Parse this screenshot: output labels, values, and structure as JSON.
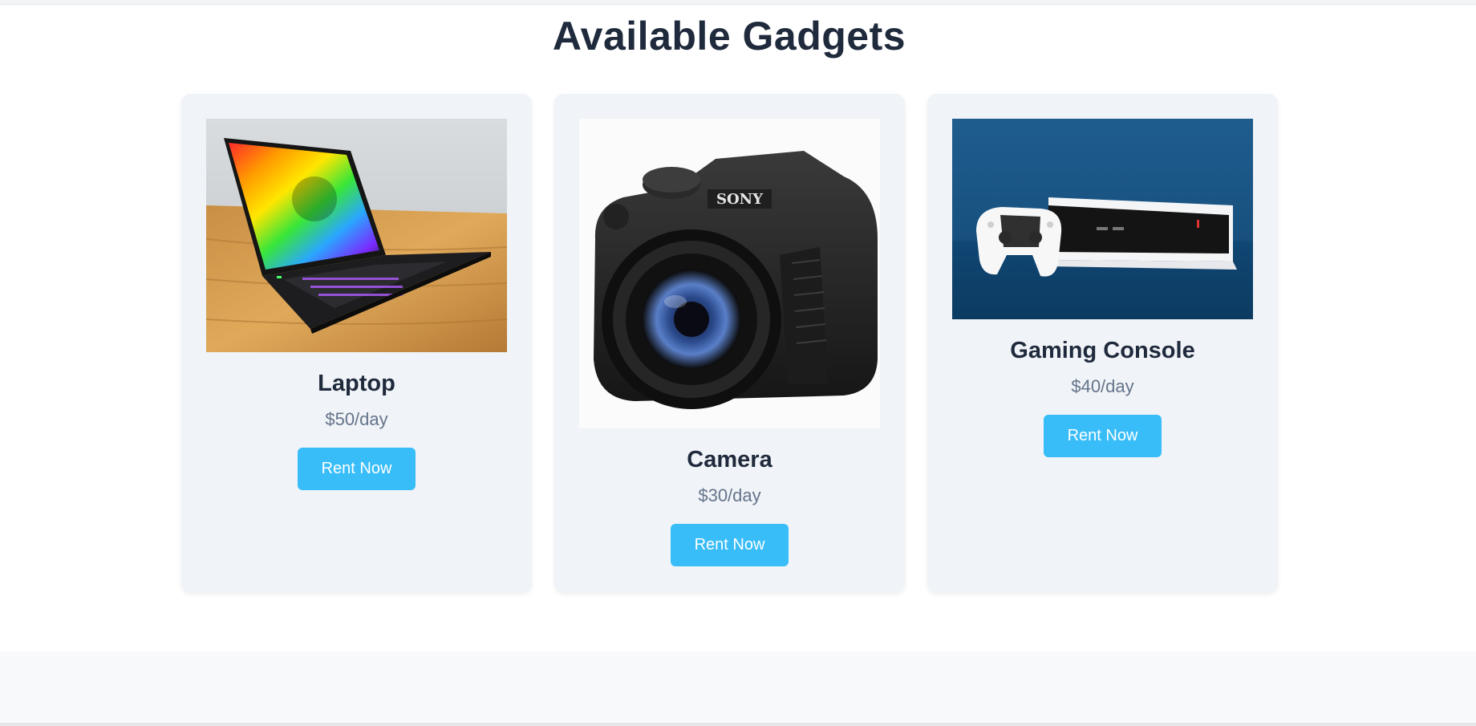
{
  "page": {
    "title": "Available Gadgets"
  },
  "gadgets": [
    {
      "name": "Laptop",
      "price": "$50/day",
      "button": "Rent Now",
      "image": "laptop-photo"
    },
    {
      "name": "Camera",
      "price": "$30/day",
      "button": "Rent Now",
      "image": "camera-photo"
    },
    {
      "name": "Gaming Console",
      "price": "$40/day",
      "button": "Rent Now",
      "image": "gaming-console-photo"
    }
  ],
  "colors": {
    "accent": "#38bdf8",
    "card_background": "#f0f3f7",
    "heading": "#1f2a3c",
    "price": "#64748b"
  }
}
